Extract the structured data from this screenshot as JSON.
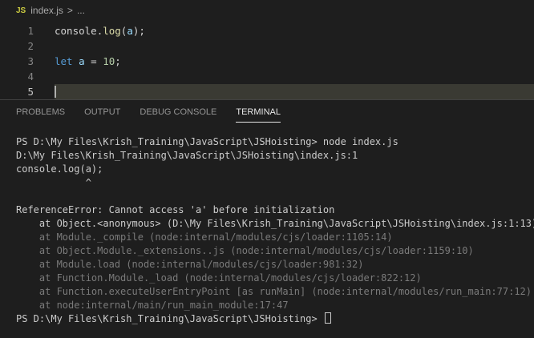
{
  "breadcrumb": {
    "icon": "js-file-icon",
    "icon_text": "JS",
    "file": "index.js",
    "separator": ">",
    "more": "..."
  },
  "editor": {
    "lines": [
      {
        "number": "1",
        "code": [
          {
            "t": "console",
            "c": "plain"
          },
          {
            "t": ".",
            "c": "plain"
          },
          {
            "t": "log",
            "c": "fn"
          },
          {
            "t": "(",
            "c": "plain"
          },
          {
            "t": "a",
            "c": "var"
          },
          {
            "t": ");",
            "c": "plain"
          }
        ]
      },
      {
        "number": "2",
        "code": []
      },
      {
        "number": "3",
        "code": [
          {
            "t": "let",
            "c": "kw"
          },
          {
            "t": " ",
            "c": "plain"
          },
          {
            "t": "a",
            "c": "var"
          },
          {
            "t": " = ",
            "c": "plain"
          },
          {
            "t": "10",
            "c": "num"
          },
          {
            "t": ";",
            "c": "plain"
          }
        ]
      },
      {
        "number": "4",
        "code": []
      },
      {
        "number": "5",
        "code": []
      }
    ],
    "active_line": 5
  },
  "panel": {
    "tabs": [
      {
        "label": "PROBLEMS",
        "active": false
      },
      {
        "label": "OUTPUT",
        "active": false
      },
      {
        "label": "DEBUG CONSOLE",
        "active": false
      },
      {
        "label": "TERMINAL",
        "active": true
      }
    ]
  },
  "terminal": {
    "lines": [
      {
        "text": "PS D:\\My Files\\Krish_Training\\JavaScript\\JSHoisting> node index.js",
        "dim": false
      },
      {
        "text": "D:\\My Files\\Krish_Training\\JavaScript\\JSHoisting\\index.js:1",
        "dim": false
      },
      {
        "text": "console.log(a);",
        "dim": false
      },
      {
        "text": "            ^",
        "dim": false
      },
      {
        "text": "",
        "dim": false
      },
      {
        "text": "ReferenceError: Cannot access 'a' before initialization",
        "dim": false
      },
      {
        "text": "    at Object.<anonymous> (D:\\My Files\\Krish_Training\\JavaScript\\JSHoisting\\index.js:1:13)",
        "dim": false
      },
      {
        "text": "    at Module._compile (node:internal/modules/cjs/loader:1105:14)",
        "dim": true
      },
      {
        "text": "    at Object.Module._extensions..js (node:internal/modules/cjs/loader:1159:10)",
        "dim": true
      },
      {
        "text": "    at Module.load (node:internal/modules/cjs/loader:981:32)",
        "dim": true
      },
      {
        "text": "    at Function.Module._load (node:internal/modules/cjs/loader:822:12)",
        "dim": true
      },
      {
        "text": "    at Function.executeUserEntryPoint [as runMain] (node:internal/modules/run_main:77:12)",
        "dim": true
      },
      {
        "text": "    at node:internal/main/run_main_module:17:47",
        "dim": true
      }
    ],
    "prompt": "PS D:\\My Files\\Krish_Training\\JavaScript\\JSHoisting> "
  }
}
